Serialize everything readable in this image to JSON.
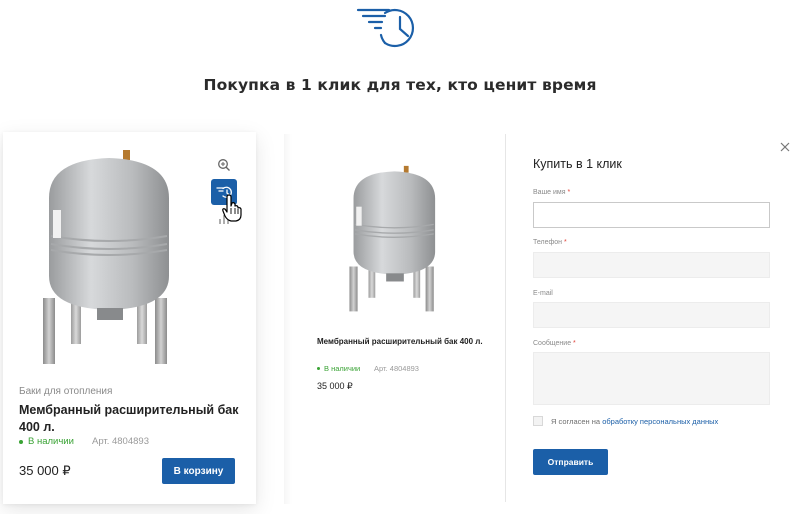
{
  "header": {
    "title": "Покупка в 1 клик для тех, кто ценит время",
    "icon": "fast-clock-icon"
  },
  "product_card": {
    "category": "Баки для отопления",
    "name": "Мембранный расширительный бак 400 л.",
    "stock": "В наличии",
    "article": "Арт. 4804893",
    "price": "35 000 ₽",
    "cart_button": "В корзину",
    "icons": [
      "zoom-icon",
      "fast-buy-icon",
      "compare-icon",
      "hand-cursor-icon"
    ]
  },
  "modal": {
    "product": {
      "name": "Мембранный расширительный бак 400 л.",
      "stock": "В наличии",
      "article": "Арт. 4804893",
      "price": "35 000 ₽"
    },
    "form": {
      "title": "Купить в 1 клик",
      "name_label": "Ваше имя",
      "phone_label": "Телефон",
      "email_label": "E-mail",
      "message_label": "Сообщение",
      "required_mark": "*",
      "consent_prefix": "Я согласен на",
      "consent_link": "обработку персональных данных",
      "submit": "Отправить"
    }
  },
  "colors": {
    "accent": "#1b5fa8",
    "in_stock": "#3aa335",
    "required": "#e0443a"
  }
}
